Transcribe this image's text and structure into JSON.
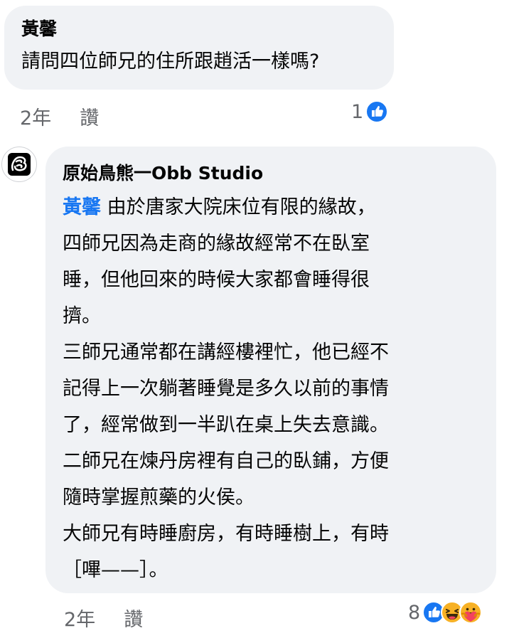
{
  "comment": {
    "author": "黃馨",
    "text": "請問四位師兄的住所跟趙活一樣嗎?",
    "time": "2年",
    "like_label": "讚",
    "reaction_count": "1",
    "reaction_icons": [
      "like-icon"
    ]
  },
  "reply": {
    "author": "原始鳥熊一Obb Studio",
    "mention": "黃馨",
    "lines": [
      " 由於唐家大院床位有限的緣故，",
      "四師兄因為走商的緣故經常不在臥室",
      "睡，但他回來的時候大家都會睡得很",
      "擠。",
      "三師兄通常都在講經樓裡忙，他已經不",
      "記得上一次躺著睡覺是多久以前的事情",
      "了，經常做到一半趴在桌上失去意識。",
      "二師兄在煉丹房裡有自己的臥鋪，方便",
      "隨時掌握煎藥的火侯。",
      "大師兄有時睡廚房，有時睡樹上，有時",
      "［嗶——］。"
    ],
    "time": "2年",
    "like_label": "讚",
    "reaction_count": "8",
    "reaction_icons": [
      "like-icon",
      "laugh-icon",
      "care-icon"
    ]
  },
  "colors": {
    "bubble": "#f0f2f5",
    "meta_text": "#65676b",
    "mention": "#1877f2",
    "like_blue": "#1877f2"
  }
}
